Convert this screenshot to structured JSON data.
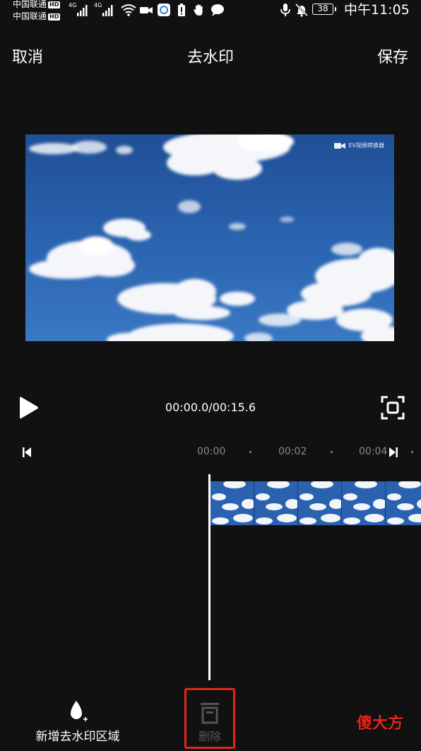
{
  "status_bar": {
    "carrier1": "中国联通",
    "carrier2": "中国联通",
    "hd1": "HD",
    "hd2": "HD",
    "net1": "4G",
    "net2": "4G",
    "battery": "38",
    "time": "中午11:05"
  },
  "header": {
    "cancel_label": "取消",
    "title": "去水印",
    "save_label": "保存"
  },
  "preview": {
    "watermark_text": "EV视频转换器"
  },
  "player": {
    "time_readout": "00:00.0/00:15.6"
  },
  "ruler": {
    "ticks": [
      "00:00",
      "00:02",
      "00:04"
    ]
  },
  "bottom_bar": {
    "add_label": "新增去水印区域",
    "delete_label": "删除",
    "brand_text": "傻大方"
  },
  "colors": {
    "background": "#111111",
    "highlight_border": "#e0261c",
    "brand_red": "#e8241c"
  }
}
